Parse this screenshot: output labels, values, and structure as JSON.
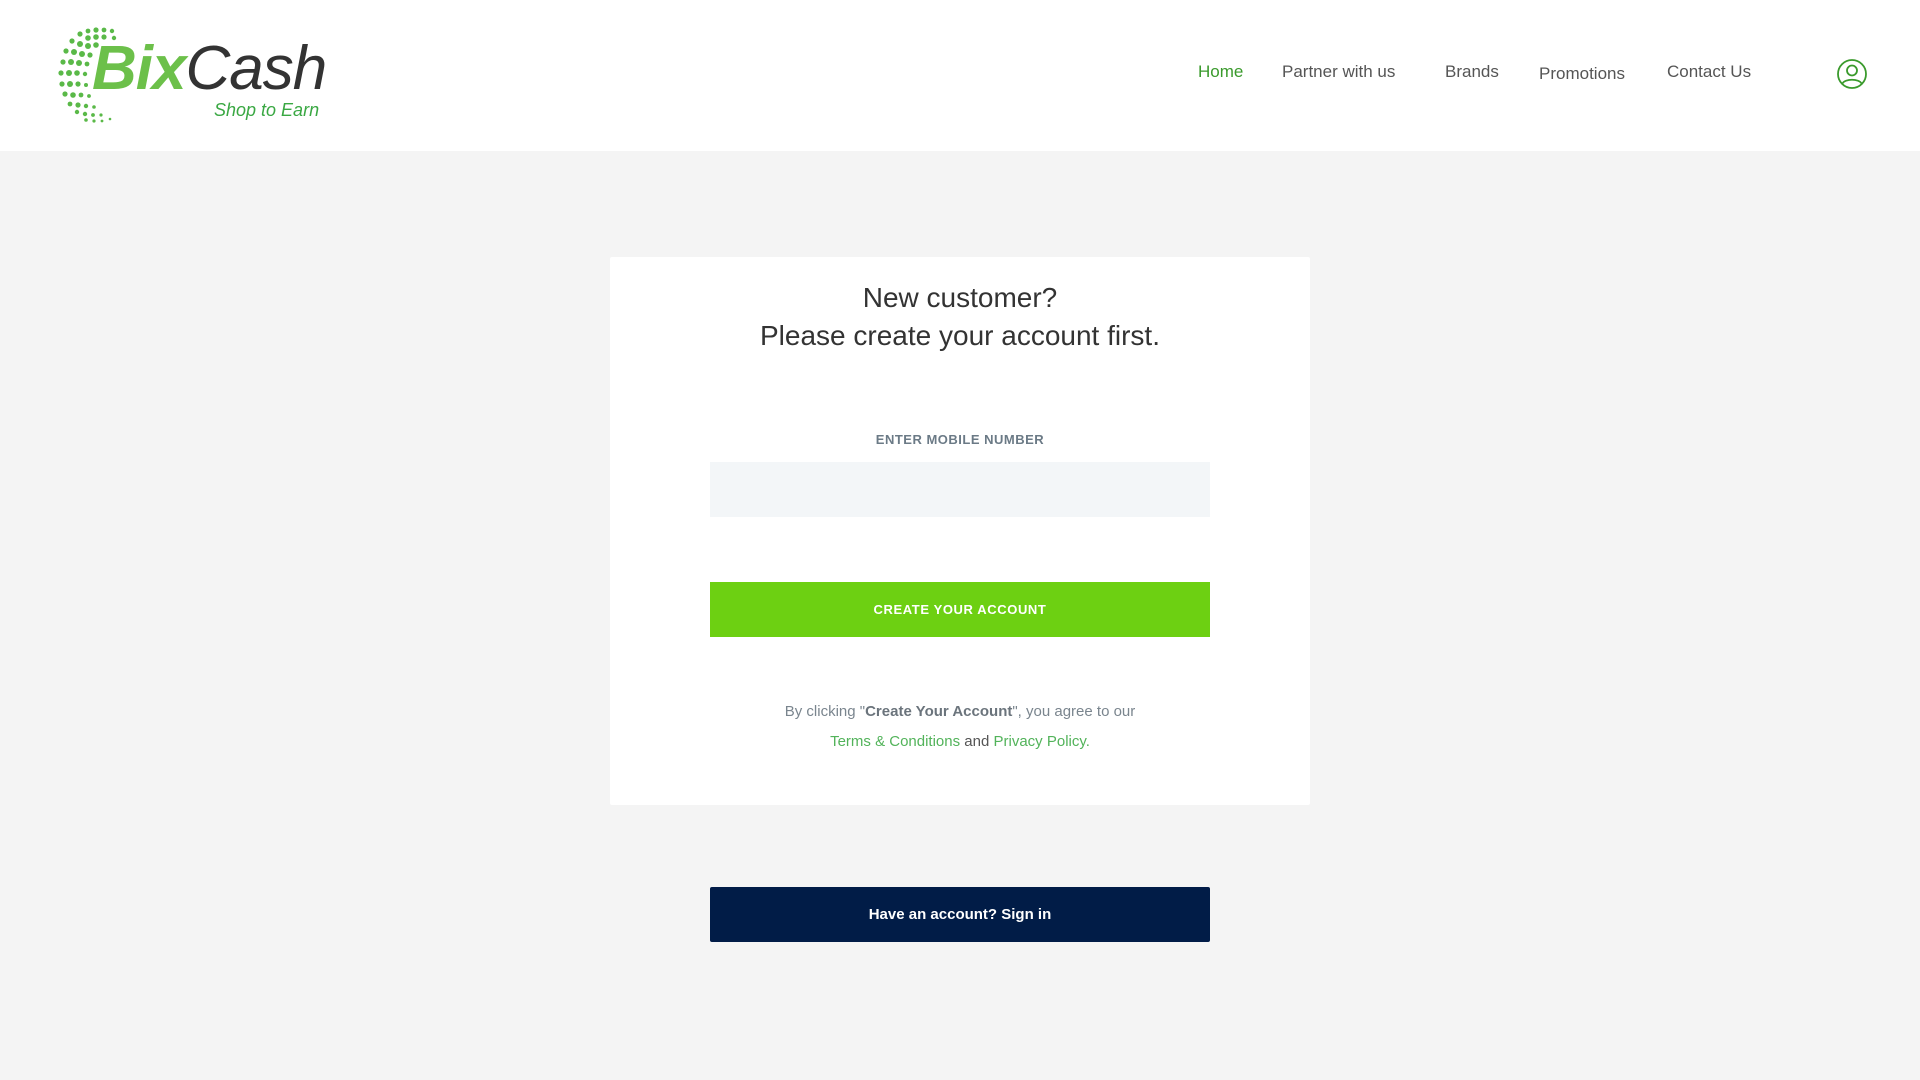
{
  "brand": {
    "name_part1": "Bix",
    "name_part2": "Cash",
    "tagline": "Shop to Earn",
    "primary_color": "#6cc04a",
    "dark_color": "#011c47"
  },
  "nav": {
    "items": [
      {
        "label": "Home",
        "active": true
      },
      {
        "label": "Partner with us",
        "active": false
      },
      {
        "label": "Brands",
        "active": false
      },
      {
        "label": "Promotions",
        "active": false
      },
      {
        "label": "Contact Us",
        "active": false
      }
    ],
    "user_icon": "user-circle-icon"
  },
  "signup": {
    "title_line1": "New customer?",
    "title_line2": "Please create your account first.",
    "mobile_label": "ENTER MOBILE NUMBER",
    "mobile_value": "",
    "mobile_placeholder": "",
    "create_button": "CREATE YOUR ACCOUNT",
    "legal_prefix": "By clicking \"",
    "legal_bold": "Create Your Account",
    "legal_suffix": "\", you agree to our",
    "terms_link": "Terms & Conditions",
    "and_text": "and",
    "privacy_link": "Privacy Policy",
    "period": "."
  },
  "signin": {
    "button_label": "Have an account? Sign in"
  }
}
